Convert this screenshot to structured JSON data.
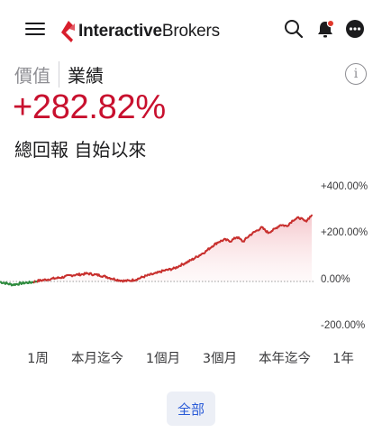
{
  "header": {
    "logo": {
      "bold": "Interactive",
      "light": "Brokers"
    },
    "icons": {
      "menu": "menu-icon",
      "search": "search-icon",
      "notifications": "bell-icon",
      "more": "more-icon"
    },
    "colors": {
      "brand": "#d81e2c",
      "notification_dot": "#e0382c"
    }
  },
  "tabs": [
    {
      "label": "價值",
      "active": false
    },
    {
      "label": "業績",
      "active": true
    }
  ],
  "info_label": "i",
  "summary": {
    "return_value": "+282.82%",
    "return_label": "總回報 自始以來",
    "value_color": "#c8102e"
  },
  "chart_data": {
    "type": "line",
    "y_ticks": [
      "+400.00%",
      "+200.00%",
      "0.00%",
      "-200.00%"
    ],
    "ylim": [
      -200,
      400
    ],
    "series": [
      {
        "color_positive": "#c8302e",
        "color_negative": "#2e8b3e",
        "values": [
          -2,
          -8,
          -14,
          -10,
          -6,
          -4,
          2,
          6,
          10,
          14,
          18,
          24,
          28,
          30,
          34,
          30,
          26,
          20,
          12,
          6,
          2,
          4,
          10,
          20,
          28,
          34,
          44,
          50,
          56,
          70,
          82,
          96,
          112,
          128,
          150,
          168,
          178,
          172,
          190,
          170,
          196,
          214,
          230,
          208,
          222,
          242,
          236,
          262,
          272,
          256,
          282
        ]
      }
    ]
  },
  "periods": [
    {
      "label": "1周"
    },
    {
      "label": "本月迄今"
    },
    {
      "label": "1個月"
    },
    {
      "label": "3個月"
    },
    {
      "label": "本年迄今"
    },
    {
      "label": "1年"
    }
  ],
  "all_button": {
    "label": "全部",
    "color": "#2a5bd7"
  }
}
